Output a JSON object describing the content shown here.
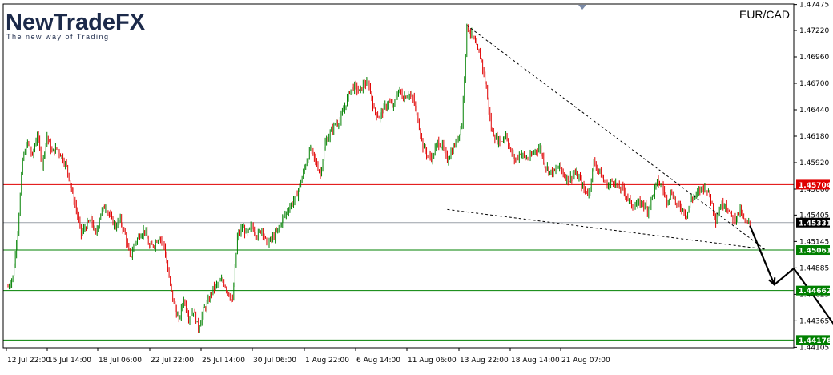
{
  "chart_data": {
    "type": "candlestick",
    "symbol": "EUR/CAD",
    "y_axis": {
      "ylim": [
        1.441,
        1.4748
      ],
      "tick_labels": [
        "1.47475",
        "1.47220",
        "1.46960",
        "1.46700",
        "1.46440",
        "1.46180",
        "1.45920",
        "1.45660",
        "1.45405",
        "1.45145",
        "1.44885",
        "1.44625",
        "1.44365",
        "1.44105"
      ]
    },
    "x_axis": {
      "tick_labels": [
        "12 Jul 22:00",
        "15 Jul 14:00",
        "18 Jul 06:00",
        "22 Jul 22:00",
        "25 Jul 14:00",
        "30 Jul 06:00",
        "1 Aug 22:00",
        "6 Aug 14:00",
        "11 Aug 06:00",
        "13 Aug 22:00",
        "18 Aug 14:00",
        "21 Aug 07:00"
      ]
    },
    "price_path": [
      [
        0,
        1.447
      ],
      [
        1,
        1.448
      ],
      [
        2,
        1.4525
      ],
      [
        3,
        1.4595
      ],
      [
        4,
        1.4612
      ],
      [
        5,
        1.4598
      ],
      [
        6,
        1.462
      ],
      [
        7,
        1.459
      ],
      [
        8,
        1.4618
      ],
      [
        9,
        1.4602
      ],
      [
        10,
        1.4606
      ],
      [
        11,
        1.4598
      ],
      [
        12,
        1.4588
      ],
      [
        13,
        1.4566
      ],
      [
        14,
        1.4546
      ],
      [
        15,
        1.4522
      ],
      [
        16,
        1.453
      ],
      [
        17,
        1.4536
      ],
      [
        18,
        1.4521
      ],
      [
        19,
        1.4543
      ],
      [
        20,
        1.455
      ],
      [
        21,
        1.4538
      ],
      [
        22,
        1.4529
      ],
      [
        23,
        1.4536
      ],
      [
        24,
        1.4521
      ],
      [
        25,
        1.4498
      ],
      [
        26,
        1.4513
      ],
      [
        27,
        1.4521
      ],
      [
        28,
        1.4526
      ],
      [
        29,
        1.4508
      ],
      [
        30,
        1.4512
      ],
      [
        31,
        1.452
      ],
      [
        32,
        1.451
      ],
      [
        33,
        1.4478
      ],
      [
        34,
        1.4452
      ],
      [
        35,
        1.4437
      ],
      [
        36,
        1.4458
      ],
      [
        37,
        1.444
      ],
      [
        38,
        1.4447
      ],
      [
        39,
        1.4429
      ],
      [
        40,
        1.4446
      ],
      [
        41,
        1.4455
      ],
      [
        42,
        1.4468
      ],
      [
        43,
        1.4473
      ],
      [
        44,
        1.4476
      ],
      [
        45,
        1.4465
      ],
      [
        46,
        1.4455
      ],
      [
        47,
        1.4519
      ],
      [
        48,
        1.4528
      ],
      [
        49,
        1.4522
      ],
      [
        50,
        1.453
      ],
      [
        51,
        1.452
      ],
      [
        52,
        1.4527
      ],
      [
        53,
        1.4512
      ],
      [
        54,
        1.4517
      ],
      [
        55,
        1.4523
      ],
      [
        56,
        1.4534
      ],
      [
        57,
        1.4543
      ],
      [
        58,
        1.4551
      ],
      [
        59,
        1.4558
      ],
      [
        60,
        1.4573
      ],
      [
        61,
        1.4591
      ],
      [
        62,
        1.4606
      ],
      [
        63,
        1.4593
      ],
      [
        64,
        1.4581
      ],
      [
        65,
        1.4611
      ],
      [
        66,
        1.4621
      ],
      [
        67,
        1.463
      ],
      [
        68,
        1.4633
      ],
      [
        69,
        1.4647
      ],
      [
        70,
        1.4663
      ],
      [
        71,
        1.4667
      ],
      [
        72,
        1.4662
      ],
      [
        73,
        1.467
      ],
      [
        74,
        1.4668
      ],
      [
        75,
        1.4643
      ],
      [
        76,
        1.4637
      ],
      [
        77,
        1.4645
      ],
      [
        78,
        1.4651
      ],
      [
        79,
        1.4647
      ],
      [
        80,
        1.4664
      ],
      [
        81,
        1.4656
      ],
      [
        82,
        1.466
      ],
      [
        83,
        1.4655
      ],
      [
        84,
        1.4634
      ],
      [
        85,
        1.4608
      ],
      [
        86,
        1.4599
      ],
      [
        87,
        1.4597
      ],
      [
        88,
        1.4612
      ],
      [
        89,
        1.4608
      ],
      [
        90,
        1.4595
      ],
      [
        91,
        1.4604
      ],
      [
        92,
        1.4615
      ],
      [
        93,
        1.463
      ],
      [
        94,
        1.4725
      ],
      [
        95,
        1.4718
      ],
      [
        96,
        1.4705
      ],
      [
        97,
        1.4692
      ],
      [
        98,
        1.4665
      ],
      [
        99,
        1.4625
      ],
      [
        100,
        1.4615
      ],
      [
        101,
        1.4612
      ],
      [
        102,
        1.462
      ],
      [
        103,
        1.4602
      ],
      [
        104,
        1.4594
      ],
      [
        105,
        1.4602
      ],
      [
        106,
        1.4596
      ],
      [
        107,
        1.4597
      ],
      [
        108,
        1.4604
      ],
      [
        109,
        1.4606
      ],
      [
        110,
        1.459
      ],
      [
        111,
        1.4583
      ],
      [
        112,
        1.4583
      ],
      [
        113,
        1.4589
      ],
      [
        114,
        1.4579
      ],
      [
        115,
        1.4575
      ],
      [
        116,
        1.4582
      ],
      [
        117,
        1.4577
      ],
      [
        118,
        1.4565
      ],
      [
        119,
        1.4562
      ],
      [
        120,
        1.4592
      ],
      [
        121,
        1.4585
      ],
      [
        122,
        1.4574
      ],
      [
        123,
        1.4569
      ],
      [
        124,
        1.4575
      ],
      [
        125,
        1.4567
      ],
      [
        126,
        1.4566
      ],
      [
        127,
        1.4557
      ],
      [
        128,
        1.4548
      ],
      [
        129,
        1.4551
      ],
      [
        130,
        1.4553
      ],
      [
        131,
        1.4545
      ],
      [
        132,
        1.4559
      ],
      [
        133,
        1.4573
      ],
      [
        134,
        1.4569
      ],
      [
        135,
        1.4555
      ],
      [
        136,
        1.4563
      ],
      [
        137,
        1.455
      ],
      [
        138,
        1.4548
      ],
      [
        139,
        1.454
      ],
      [
        140,
        1.4557
      ],
      [
        141,
        1.456
      ],
      [
        142,
        1.4567
      ],
      [
        143,
        1.4568
      ],
      [
        144,
        1.4556
      ],
      [
        145,
        1.4536
      ],
      [
        146,
        1.455
      ],
      [
        147,
        1.4552
      ],
      [
        148,
        1.454
      ],
      [
        149,
        1.4537
      ],
      [
        150,
        1.4545
      ],
      [
        151,
        1.4533
      ],
      [
        152,
        1.4532
      ]
    ],
    "levels": [
      {
        "price": 1.45704,
        "label": "1.45704",
        "color": "#e00000"
      },
      {
        "price": 1.45061,
        "label": "1.45061",
        "color": "#008000"
      },
      {
        "price": 1.44662,
        "label": "1.44662",
        "color": "#008000"
      },
      {
        "price": 1.44176,
        "label": "1.44176",
        "color": "#008000"
      }
    ],
    "current_price": {
      "price": 1.45331,
      "label": "1.45331",
      "color": "#000000"
    },
    "trendlines": [
      {
        "from": [
          94,
          1.4727
        ],
        "to": [
          155,
          1.4507
        ]
      },
      {
        "from": [
          90,
          1.4546
        ],
        "to": [
          155,
          1.4507
        ]
      }
    ],
    "forecast_path": [
      [
        1.453,
        152
      ],
      [
        1.4472,
        157
      ],
      [
        1.4488,
        161
      ],
      [
        1.4421,
        171
      ]
    ],
    "colors": {
      "bull": "#008000",
      "bear": "#e00000",
      "grid": "#cccccc"
    }
  },
  "logo": {
    "name_a": "NewTrade",
    "name_b": "FX",
    "tagline": "The new way of Trading"
  }
}
